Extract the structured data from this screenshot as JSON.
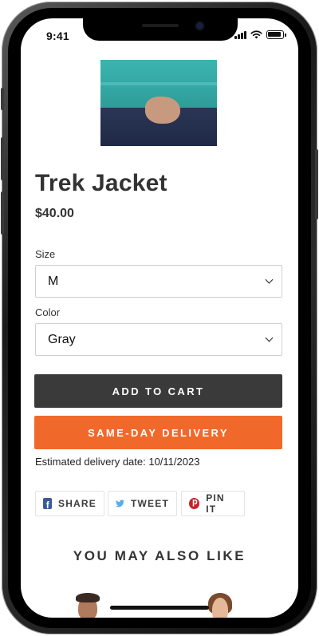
{
  "status_bar": {
    "time": "9:41"
  },
  "product": {
    "title": "Trek Jacket",
    "price": "$40.00",
    "image_alt": "teal jacket sleeve and navy pants"
  },
  "size": {
    "label": "Size",
    "value": "M"
  },
  "color": {
    "label": "Color",
    "value": "Gray"
  },
  "actions": {
    "add_to_cart": "ADD TO CART",
    "same_day_delivery": "SAME-DAY DELIVERY"
  },
  "delivery": {
    "estimate_text": "Estimated delivery date: 10/11/2023"
  },
  "social": {
    "share": "SHARE",
    "tweet": "TWEET",
    "pin": "PIN IT"
  },
  "recommendations": {
    "heading": "YOU MAY ALSO LIKE"
  },
  "colors": {
    "primary_button": "#3a3a3a",
    "accent_button": "#f1692a",
    "facebook": "#3b5998",
    "twitter": "#55acee",
    "pinterest": "#c8232c"
  },
  "icons": [
    "facebook-icon",
    "twitter-icon",
    "pinterest-icon",
    "chevron-down-icon",
    "signal-icon",
    "wifi-icon",
    "battery-icon"
  ]
}
